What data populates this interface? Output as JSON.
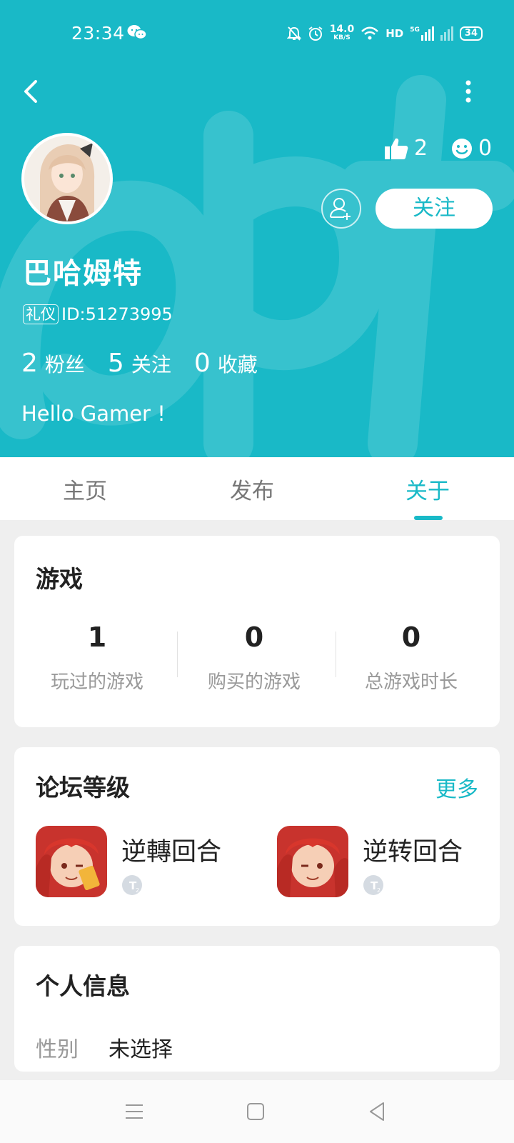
{
  "status": {
    "time": "23:34",
    "speed_value": "14.0",
    "speed_unit": "KB/S",
    "hd": "HD",
    "net": "5G",
    "battery": "34"
  },
  "profile": {
    "name": "巴哈姆特",
    "badge": "礼仪",
    "id": "ID:51273995",
    "likes": "2",
    "smiles": "0",
    "follow_label": "关注",
    "fans_count": "2",
    "fans_label": "粉丝",
    "following_count": "5",
    "following_label": "关注",
    "favorites_count": "0",
    "favorites_label": "收藏",
    "bio": "Hello Gamer !"
  },
  "tabs": [
    {
      "label": "主页",
      "active": false
    },
    {
      "label": "发布",
      "active": false
    },
    {
      "label": "关于",
      "active": true
    }
  ],
  "games": {
    "title": "游戏",
    "stats": [
      {
        "value": "1",
        "label": "玩过的游戏"
      },
      {
        "value": "0",
        "label": "购买的游戏"
      },
      {
        "value": "0",
        "label": "总游戏时长"
      }
    ]
  },
  "forum": {
    "title": "论坛等级",
    "more": "更多",
    "items": [
      {
        "name": "逆轉回合",
        "level": "T2"
      },
      {
        "name": "逆转回合",
        "level": "T2"
      }
    ]
  },
  "info": {
    "title": "个人信息",
    "gender_label": "性别",
    "gender_value": "未选择"
  },
  "theme": {
    "accent": "#19b9c7"
  }
}
